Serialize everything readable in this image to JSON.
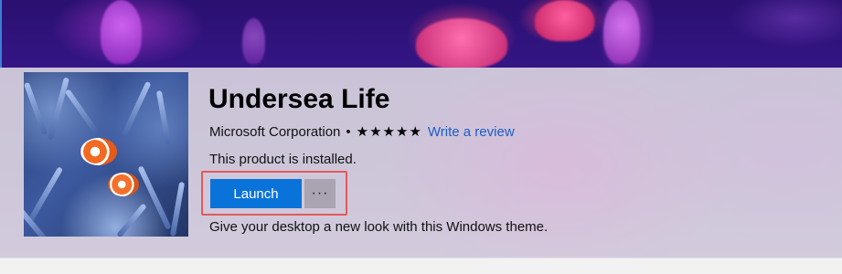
{
  "hero": {
    "background": "deep-sea jellyfish banner"
  },
  "product": {
    "title": "Undersea Life",
    "publisher": "Microsoft Corporation",
    "separator": "•",
    "stars": "★★★★★",
    "rating": 5,
    "review_link": "Write a review",
    "status": "This product is installed.",
    "description": "Give your desktop a new look with this Windows theme.",
    "image_icon": "clownfish-anemone-thumbnail"
  },
  "actions": {
    "launch_label": "Launch",
    "more_label": "···"
  },
  "colors": {
    "launch_bg": "#0a73d9",
    "link": "#1a5fc8",
    "highlight_border": "#e35a5a",
    "more_bg": "#a9a3b2"
  }
}
